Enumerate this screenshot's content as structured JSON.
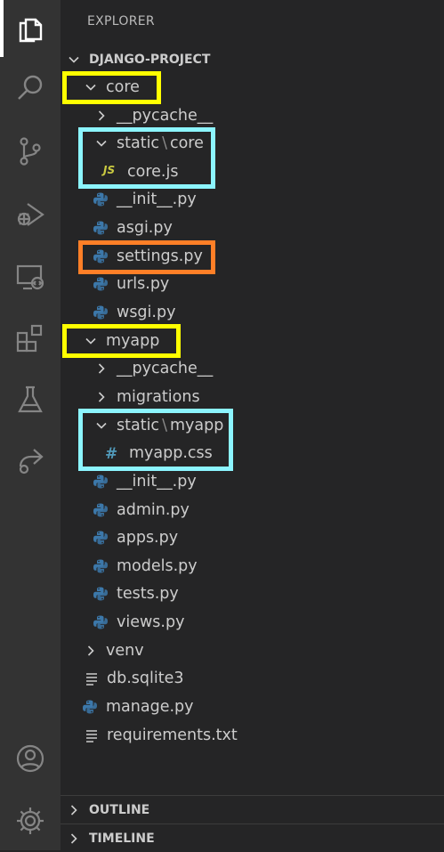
{
  "explorer": {
    "title": "EXPLORER",
    "project": "DJANGO-PROJECT"
  },
  "tree": {
    "core": "core",
    "core_pycache": "__pycache__",
    "core_static_a": "static",
    "core_static_sep": "\\",
    "core_static_b": "core",
    "core_js": "core.js",
    "core_init": "__init__.py",
    "core_asgi": "asgi.py",
    "core_settings": "settings.py",
    "core_urls": "urls.py",
    "core_wsgi": "wsgi.py",
    "myapp": "myapp",
    "myapp_pycache": "__pycache__",
    "myapp_migrations": "migrations",
    "myapp_static_a": "static",
    "myapp_static_sep": "\\",
    "myapp_static_b": "myapp",
    "myapp_css": "myapp.css",
    "myapp_init": "__init__.py",
    "myapp_admin": "admin.py",
    "myapp_apps": "apps.py",
    "myapp_models": "models.py",
    "myapp_tests": "tests.py",
    "myapp_views": "views.py",
    "venv": "venv",
    "db": "db.sqlite3",
    "manage": "manage.py",
    "requirements": "requirements.txt"
  },
  "icons": {
    "js_glyph": "JS",
    "css_glyph": "#"
  },
  "sections": {
    "outline": "OUTLINE",
    "timeline": "TIMELINE"
  },
  "colors": {
    "highlight_yellow": "#ffff00",
    "highlight_cyan": "#8cf5ff",
    "highlight_orange": "#ff7f27",
    "python_icon": "#3c78aa",
    "js_icon": "#cbcb41",
    "css_icon": "#519aba"
  }
}
